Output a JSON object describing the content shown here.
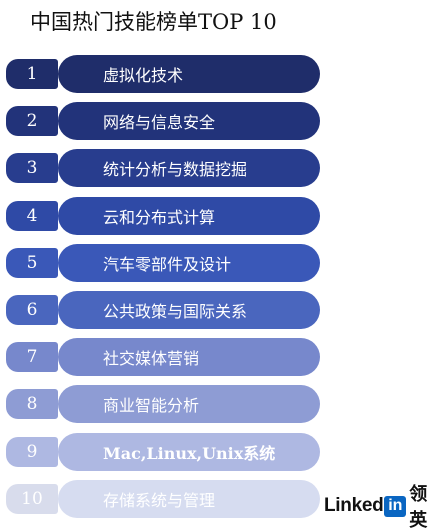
{
  "title": "中国热门技能榜单TOP 10",
  "skills": [
    {
      "rank": "1",
      "label": "虚拟化技术",
      "color": "#1f2d6a",
      "num_color": "#1f2d6a"
    },
    {
      "rank": "2",
      "label": "网络与信息安全",
      "color": "#22337a",
      "num_color": "#22337a"
    },
    {
      "rank": "3",
      "label": "统计分析与数据挖掘",
      "color": "#283d8e",
      "num_color": "#283d8e"
    },
    {
      "rank": "4",
      "label": "云和分布式计算",
      "color": "#2f4aa6",
      "num_color": "#2f4aa6"
    },
    {
      "rank": "5",
      "label": "汽车零部件及设计",
      "color": "#3a58b8",
      "num_color": "#3a58b8"
    },
    {
      "rank": "6",
      "label": "公共政策与国际关系",
      "color": "#4a66be",
      "num_color": "#4a66be"
    },
    {
      "rank": "7",
      "label": "社交媒体营销",
      "color": "#7788cc",
      "num_color": "#7788cc"
    },
    {
      "rank": "8",
      "label": "商业智能分析",
      "color": "#8e9cd4",
      "num_color": "#8e9cd4"
    },
    {
      "rank": "9",
      "label": "Mac,Linux,Unix系统",
      "color": "#aeb8e2",
      "num_color": "#aeb8e2"
    },
    {
      "rank": "10",
      "label": "存储系统与管理",
      "color": "#d6dcf0",
      "num_color": "#d8dcec"
    }
  ],
  "logo": {
    "text": "Linked",
    "in": "in",
    "cn": "领英"
  }
}
